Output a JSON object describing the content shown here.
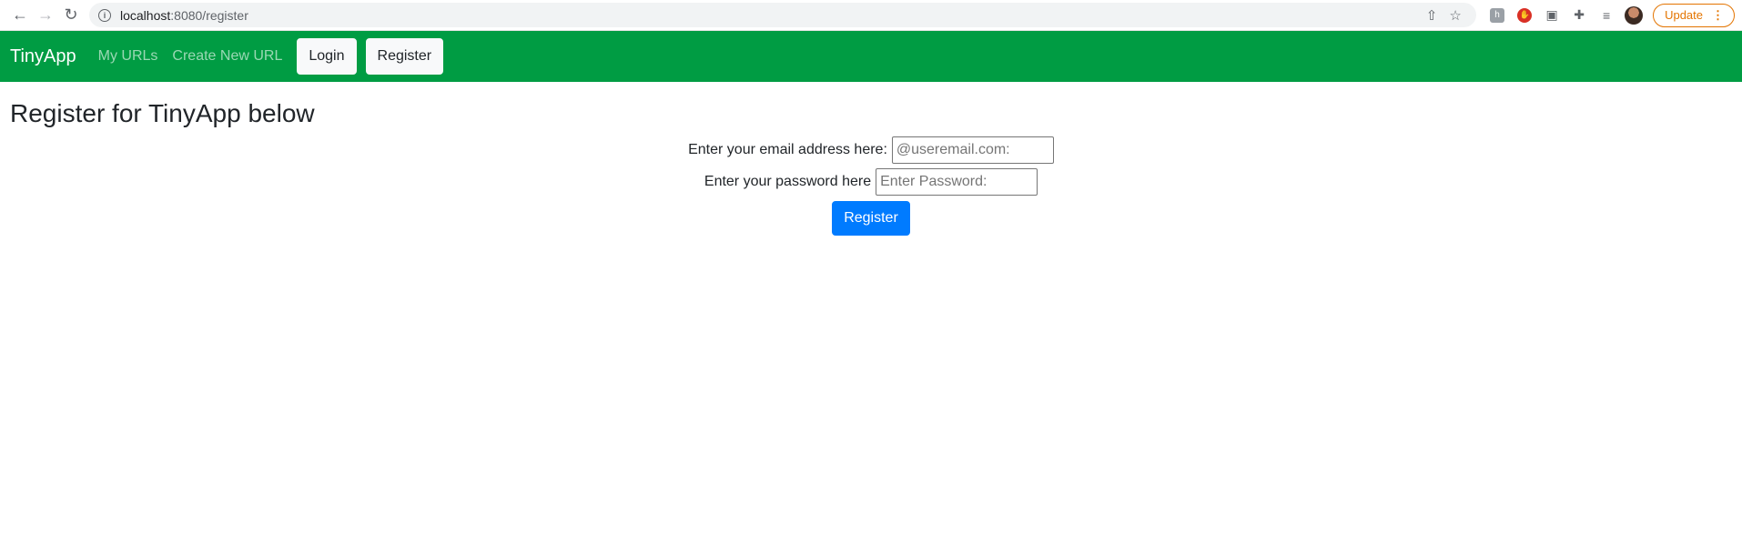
{
  "browser": {
    "url_host": "localhost",
    "url_path": ":8080/register",
    "update_label": "Update"
  },
  "navbar": {
    "brand": "TinyApp",
    "links": [
      "My URLs",
      "Create New URL"
    ],
    "login_label": "Login",
    "register_label": "Register",
    "bg_color": "#009c43"
  },
  "main": {
    "title": "Register for TinyApp below",
    "email_label": "Enter your email address here:",
    "email_placeholder": "@useremail.com:",
    "password_label": "Enter your password here",
    "password_placeholder": "Enter Password:",
    "submit_label": "Register",
    "submit_color": "#007bff"
  },
  "icons": [
    "back-arrow-icon",
    "forward-arrow-icon",
    "reload-icon",
    "info-icon",
    "share-icon",
    "star-icon",
    "extension-icon",
    "menu-dots-icon"
  ]
}
